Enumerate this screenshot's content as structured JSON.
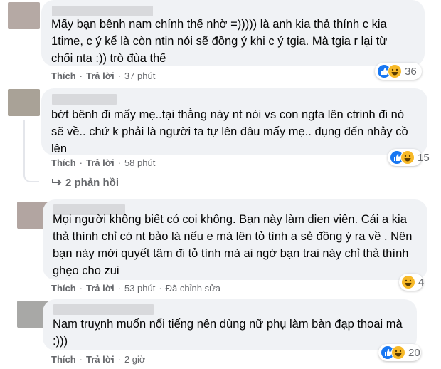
{
  "comments": [
    {
      "avatar_color": "#b5a9a4",
      "lines": [
        "Mấy bạn bênh nam chính thế nhờ =))))) là anh kia thả thính c kia",
        "1time, c ý kể là còn ntin nói sẽ đồng ý khi c ý tgia. Mà tgia r lại từ",
        "chối nta :)) trò đùa thế"
      ],
      "like": "Thích",
      "reply": "Trả lời",
      "time": "37 phút",
      "edited": "",
      "reaction_count": "36",
      "reactions": [
        "like",
        "haha"
      ]
    },
    {
      "avatar_color": "#a9a297",
      "lines": [
        "bớt bênh đi mấy mẹ..tại thằng này nt nói vs con ngta lên ctrinh đi nó",
        "sẽ về.. chứ k phải là người ta tự lên đâu mấy mẹ.. đụng đến nhảy cồ",
        "lên"
      ],
      "like": "Thích",
      "reply": "Trả lời",
      "time": "58 phút",
      "edited": "",
      "reaction_count": "15",
      "reactions": [
        "like",
        "haha"
      ]
    },
    {
      "avatar_color": "#b2a5a1",
      "lines": [
        "Mọi người không biết có coi không. Bạn này làm dien viên. Cái a kia",
        "thả thính chỉ có nt bảo là nếu e mà lên tỏ tình a sẻ đồng ý ra về . Nên",
        "bạn này mới quyết tâm đi tỏ tình mà ai ngờ bạn trai này chỉ thả thính",
        "ghẹo cho zui"
      ],
      "like": "Thích",
      "reply": "Trả lời",
      "time": "53 phút",
      "edited": "Đã chỉnh sửa",
      "reaction_count": "4",
      "reactions": [
        "haha"
      ]
    },
    {
      "avatar_color": "#a8a8a6",
      "lines": [
        "Nam truỵnh muốn nổi tiếng nên dùng nữ phụ làm bàn đạp thoai mà",
        ":)))"
      ],
      "like": "Thích",
      "reply": "Trả lời",
      "time": "2 giờ",
      "edited": "",
      "reaction_count": "20",
      "reactions": [
        "like",
        "haha"
      ]
    }
  ],
  "replies_link": "2 phản hồi",
  "colors": {
    "like_blue": "#1877f2",
    "haha_yellow": "#f7b928",
    "bubble": "#f0f2f5",
    "meta": "#65676b"
  }
}
